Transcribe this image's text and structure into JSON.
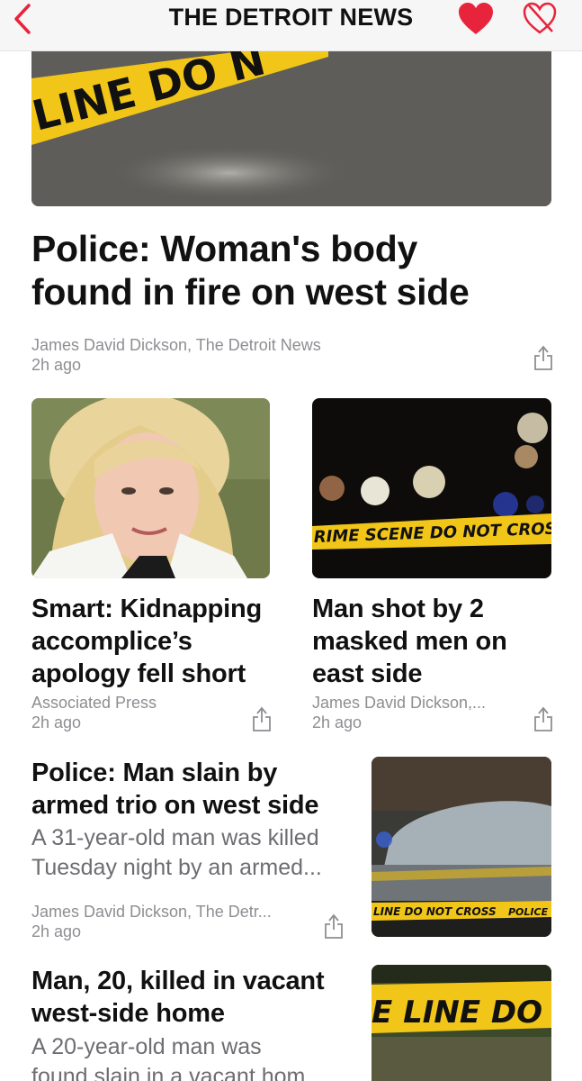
{
  "navbar": {
    "title": "THE DETROIT NEWS",
    "back_icon": "chevron-left-icon",
    "love_icon": "heart-icon",
    "dislike_icon": "broken-heart-icon",
    "accent_color": "#e8243c"
  },
  "hero": {
    "image_text": "LINE DO N",
    "title_line1": "Police: Woman's body",
    "title_line2": "found in fire on west side",
    "byline": "James David Dickson, The Detroit News",
    "time": "2h ago"
  },
  "cards": [
    {
      "title_line1": "Smart: Kidnapping",
      "title_line2": "accomplice’s",
      "title_line3": "apology fell short",
      "byline": "Associated Press",
      "time": "2h ago"
    },
    {
      "image_text": "RIME SCENE  DO NOT CROSS",
      "title_line1": "Man shot by 2",
      "title_line2": "masked men on",
      "title_line3": "east side",
      "byline": "James David Dickson,...",
      "time": "2h ago"
    }
  ],
  "list": [
    {
      "title_line1": "Police: Man slain by",
      "title_line2": "armed trio on west side",
      "summary_line1": "A 31-year-old man was killed",
      "summary_line2": "Tuesday night by an armed...",
      "byline": "James David Dickson, The Detr...",
      "time": "2h ago",
      "image_text": "LINE DO NOT CROSS",
      "image_text2": "POLICE L"
    },
    {
      "title_line1": "Man, 20, killed in vacant",
      "title_line2": "west-side home",
      "summary_line1": "A 20-year-old man was",
      "summary_line2": "found slain in a vacant hom",
      "image_text": "E LINE DO NO"
    }
  ],
  "colors": {
    "tape_yellow": "#f2c618",
    "meta_gray": "#8e8e93"
  }
}
